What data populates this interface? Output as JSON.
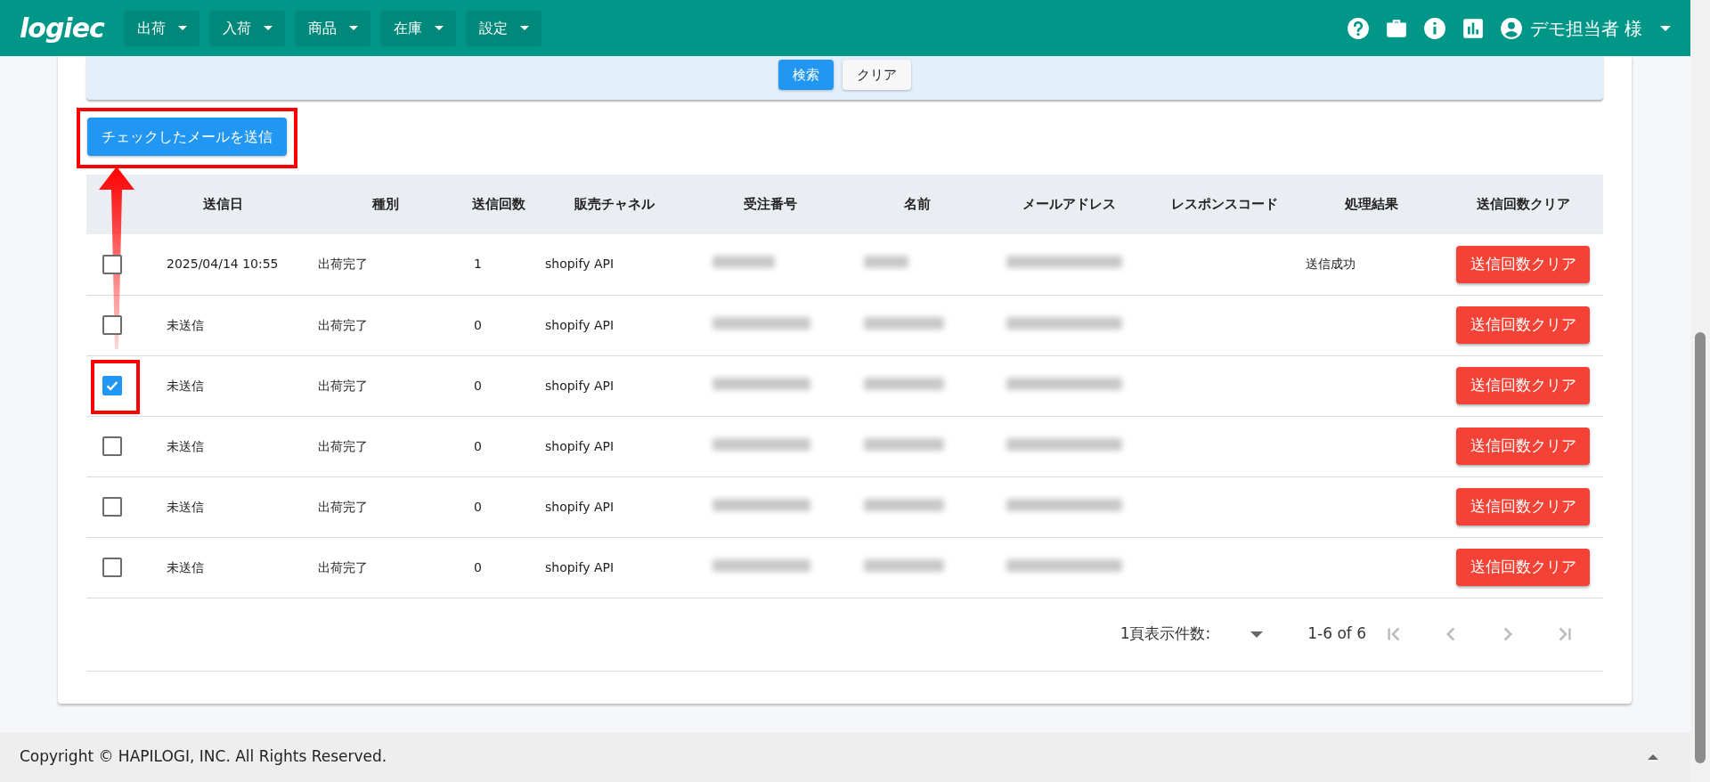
{
  "navbar": {
    "logo": "logiec",
    "menus": [
      {
        "label": "出荷"
      },
      {
        "label": "入荷"
      },
      {
        "label": "商品"
      },
      {
        "label": "在庫"
      },
      {
        "label": "設定"
      }
    ],
    "user": "デモ担当者 様"
  },
  "search_panel": {
    "buttons": [
      {
        "label": "検索",
        "kind": "primary"
      },
      {
        "label": "クリア",
        "kind": "secondary"
      }
    ]
  },
  "send_button": {
    "label": "チェックしたメールを送信",
    "highlighted": true
  },
  "annotations": [
    {
      "kind": "arrow"
    }
  ],
  "table": {
    "columns": [
      "送信日",
      "種別",
      "送信回数",
      "販売チャネル",
      "受注番号",
      "名前",
      "メールアドレス",
      "レスポンスコード",
      "処理結果",
      "送信回数クリア"
    ],
    "rows": [
      {
        "checked": false,
        "highlighted": false,
        "sent_date": "2025/04/14 10:55",
        "type": "出荷完了",
        "send_count": "1",
        "channel": "shopify API",
        "result": "送信成功",
        "clear_label": "送信回数クリア"
      },
      {
        "checked": false,
        "highlighted": false,
        "sent_date": "未送信",
        "type": "出荷完了",
        "send_count": "0",
        "channel": "shopify API",
        "clear_label": "送信回数クリア"
      },
      {
        "checked": true,
        "highlighted": true,
        "sent_date": "未送信",
        "type": "出荷完了",
        "send_count": "0",
        "channel": "shopify API",
        "clear_label": "送信回数クリア"
      },
      {
        "checked": false,
        "highlighted": false,
        "sent_date": "未送信",
        "type": "出荷完了",
        "send_count": "0",
        "channel": "shopify API",
        "clear_label": "送信回数クリア"
      },
      {
        "checked": false,
        "highlighted": false,
        "sent_date": "未送信",
        "type": "出荷完了",
        "send_count": "0",
        "channel": "shopify API",
        "clear_label": "送信回数クリア"
      },
      {
        "checked": false,
        "highlighted": false,
        "sent_date": "未送信",
        "type": "出荷完了",
        "send_count": "0",
        "channel": "shopify API",
        "clear_label": "送信回数クリア"
      }
    ]
  },
  "pagination": {
    "rows_per_page_label": "1頁表示件数:",
    "range": "1-6 of 6",
    "nav_buttons": [
      {
        "kind": "first",
        "disabled": true
      },
      {
        "kind": "prev",
        "disabled": true
      },
      {
        "kind": "next",
        "disabled": true
      },
      {
        "kind": "last",
        "disabled": true
      }
    ]
  },
  "footer": {
    "copyright": "Copyright © HAPILOGI, INC. All Rights Reserved."
  }
}
